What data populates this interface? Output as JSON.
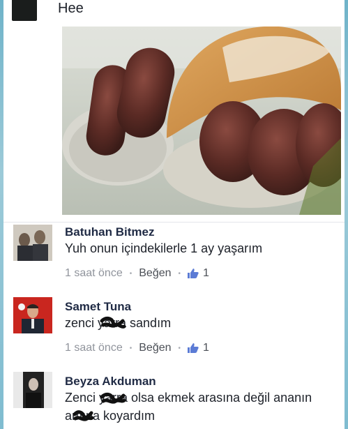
{
  "post": {
    "text": "Hee",
    "author_avatar": "dark-profile-photo",
    "photo": "sausages-in-bread-photo"
  },
  "comments": [
    {
      "author": "Batuhan Bitmez",
      "text": "Yuh onun içindekilerle 1 ay yaşarım",
      "time": "1 saat önce",
      "like_label": "Beğen",
      "likes": "1"
    },
    {
      "author": "Samet Tuna",
      "text": "zenci yarra sandım",
      "time": "1 saat önce",
      "like_label": "Beğen",
      "likes": "1"
    },
    {
      "author": "Beyza Akduman",
      "text_line1": "Zenci yarra olsa ekmek arasına değil ananın",
      "text_line2": "amına koyardım"
    }
  ],
  "icons": {
    "separator": "•",
    "like": "thumbs-up-icon"
  },
  "colors": {
    "name": "#1f2a44",
    "meta": "#90949c",
    "frame": "#7fbcd0"
  }
}
